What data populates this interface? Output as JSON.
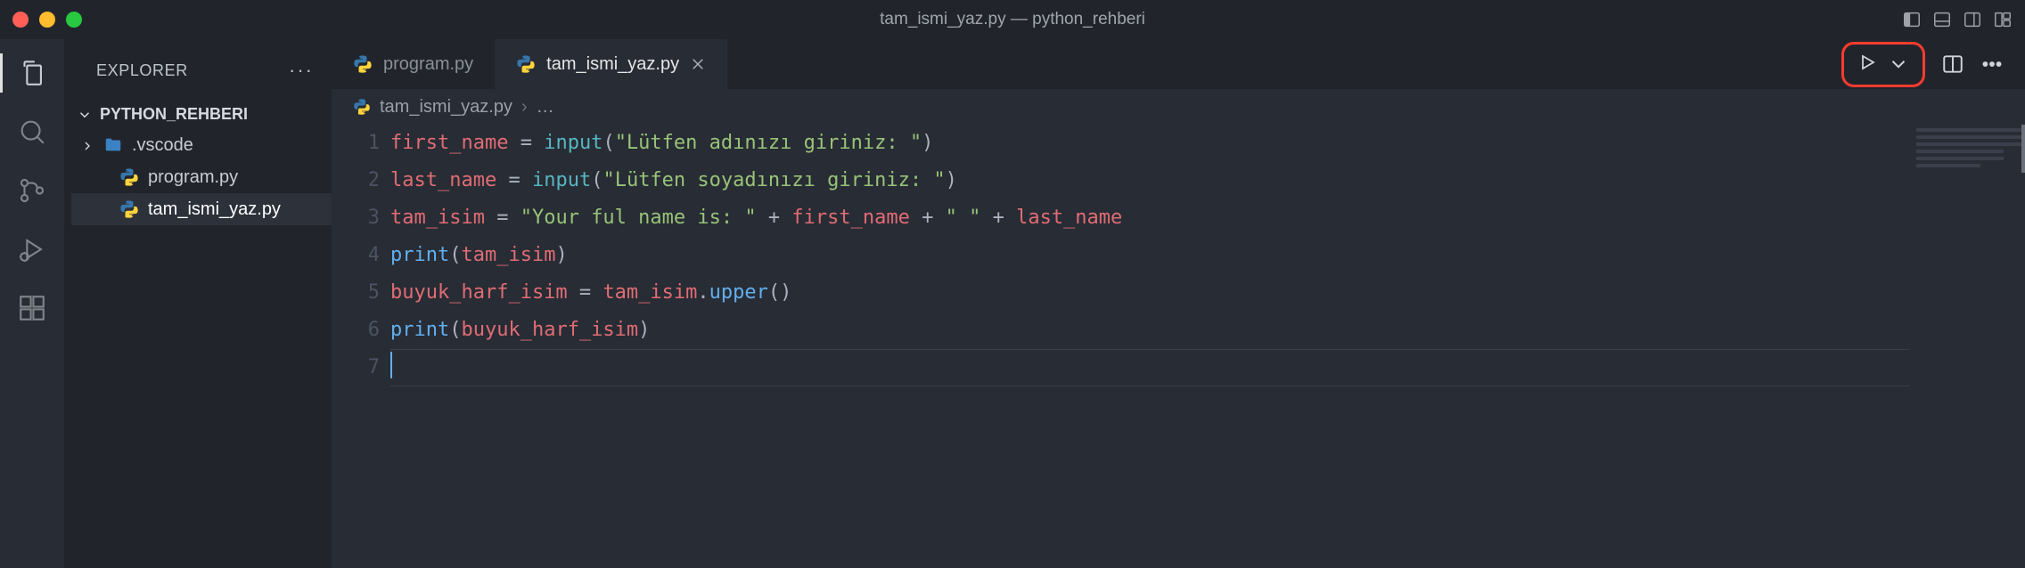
{
  "window": {
    "title": "tam_ismi_yaz.py — python_rehberi"
  },
  "sidebar": {
    "header": "EXPLORER",
    "section": "PYTHON_REHBERI",
    "items": [
      {
        "label": ".vscode",
        "kind": "folder",
        "collapsed": true
      },
      {
        "label": "program.py",
        "kind": "py"
      },
      {
        "label": "tam_ismi_yaz.py",
        "kind": "py",
        "selected": true
      }
    ]
  },
  "tabs": [
    {
      "label": "program.py",
      "active": false
    },
    {
      "label": "tam_ismi_yaz.py",
      "active": true,
      "closable": true
    }
  ],
  "breadcrumbs": {
    "file": "tam_ismi_yaz.py",
    "more": "…"
  },
  "code": {
    "lines": [
      {
        "n": 1,
        "tokens": [
          {
            "t": "first_name",
            "c": "tk-var"
          },
          {
            "t": " = ",
            "c": "tk-op"
          },
          {
            "t": "input",
            "c": "tk-fn"
          },
          {
            "t": "(",
            "c": "tk-pun"
          },
          {
            "t": "\"Lütfen adınızı giriniz: \"",
            "c": "tk-str"
          },
          {
            "t": ")",
            "c": "tk-pun"
          }
        ]
      },
      {
        "n": 2,
        "tokens": [
          {
            "t": "last_name",
            "c": "tk-var"
          },
          {
            "t": " = ",
            "c": "tk-op"
          },
          {
            "t": "input",
            "c": "tk-fn"
          },
          {
            "t": "(",
            "c": "tk-pun"
          },
          {
            "t": "\"Lütfen soyadınızı giriniz: \"",
            "c": "tk-str"
          },
          {
            "t": ")",
            "c": "tk-pun"
          }
        ]
      },
      {
        "n": 3,
        "tokens": [
          {
            "t": "tam_isim",
            "c": "tk-var"
          },
          {
            "t": " = ",
            "c": "tk-op"
          },
          {
            "t": "\"Your ful name is: \"",
            "c": "tk-str"
          },
          {
            "t": " + ",
            "c": "tk-op"
          },
          {
            "t": "first_name",
            "c": "tk-var"
          },
          {
            "t": " + ",
            "c": "tk-op"
          },
          {
            "t": "\" \"",
            "c": "tk-str"
          },
          {
            "t": " + ",
            "c": "tk-op"
          },
          {
            "t": "last_name",
            "c": "tk-var"
          }
        ]
      },
      {
        "n": 4,
        "tokens": [
          {
            "t": "print",
            "c": "tk-builtin"
          },
          {
            "t": "(",
            "c": "tk-pun"
          },
          {
            "t": "tam_isim",
            "c": "tk-var"
          },
          {
            "t": ")",
            "c": "tk-pun"
          }
        ]
      },
      {
        "n": 5,
        "tokens": [
          {
            "t": "buyuk_harf_isim",
            "c": "tk-var"
          },
          {
            "t": " = ",
            "c": "tk-op"
          },
          {
            "t": "tam_isim",
            "c": "tk-var"
          },
          {
            "t": ".",
            "c": "tk-pun"
          },
          {
            "t": "upper",
            "c": "tk-call"
          },
          {
            "t": "()",
            "c": "tk-pun"
          }
        ]
      },
      {
        "n": 6,
        "tokens": [
          {
            "t": "print",
            "c": "tk-builtin"
          },
          {
            "t": "(",
            "c": "tk-pun"
          },
          {
            "t": "buyuk_harf_isim",
            "c": "tk-var"
          },
          {
            "t": ")",
            "c": "tk-pun"
          }
        ]
      },
      {
        "n": 7,
        "tokens": []
      }
    ],
    "cursor_line": 7
  },
  "icons": {
    "activity": [
      "explorer",
      "search",
      "source-control",
      "run-debug",
      "extensions"
    ]
  }
}
